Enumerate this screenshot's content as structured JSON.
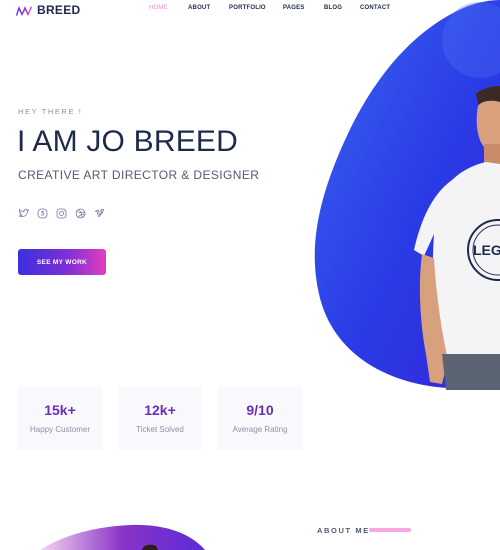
{
  "brand": {
    "name": "BREED"
  },
  "nav": {
    "items": [
      {
        "label": "HOME",
        "active": true
      },
      {
        "label": "ABOUT",
        "active": false
      },
      {
        "label": "PORTFOLIO",
        "active": false
      },
      {
        "label": "PAGES",
        "active": false
      },
      {
        "label": "BLOG",
        "active": false
      },
      {
        "label": "CONTACT",
        "active": false
      }
    ]
  },
  "hero": {
    "greeting": "HEY THERE !",
    "title": "I AM JO BREED",
    "subtitle": "CREATIVE ART DIRECTOR & DESIGNER",
    "socials": [
      "twitter-icon",
      "skype-icon",
      "instagram-icon",
      "dribbble-icon",
      "vimeo-icon"
    ],
    "cta_label": "SEE MY WORK",
    "tshirt_text": "LEGE"
  },
  "stats": [
    {
      "value": "15k+",
      "label": "Happy Customer"
    },
    {
      "value": "12k+",
      "label": "Ticket Solved"
    },
    {
      "value": "9/10",
      "label": "Average Rating"
    }
  ],
  "about": {
    "label": "ABOUT ME"
  },
  "colors": {
    "accent_blue": "#2f3be6",
    "accent_pink": "#e23fbd",
    "accent_purple": "#6a2fb6",
    "text_dark": "#1d2a4d",
    "nav_active": "#f48bd3"
  }
}
